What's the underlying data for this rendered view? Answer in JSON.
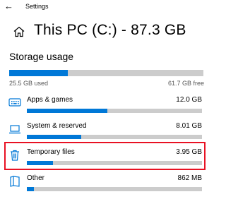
{
  "titlebar": {
    "back_glyph": "←",
    "app_title": "Settings"
  },
  "header": {
    "icon": "home-icon",
    "title": "This PC (C:) - 87.3 GB"
  },
  "storage": {
    "section_title": "Storage usage",
    "used": "25.5 GB used",
    "free": "61.7 GB free",
    "used_fraction": 0.3
  },
  "categories": [
    {
      "icon": "apps-icon",
      "label": "Apps & games",
      "size": "12.0 GB",
      "fraction": 0.46
    },
    {
      "icon": "laptop-icon",
      "label": "System & reserved",
      "size": "8.01 GB",
      "fraction": 0.31
    },
    {
      "icon": "trash-icon",
      "label": "Temporary files",
      "size": "3.95 GB",
      "fraction": 0.15,
      "selected": true
    },
    {
      "icon": "document-icon",
      "label": "Other",
      "size": "862 MB",
      "fraction": 0.04
    }
  ],
  "colors": {
    "accent": "#0078d7",
    "track": "#cccccc",
    "highlight": "#e81123"
  }
}
